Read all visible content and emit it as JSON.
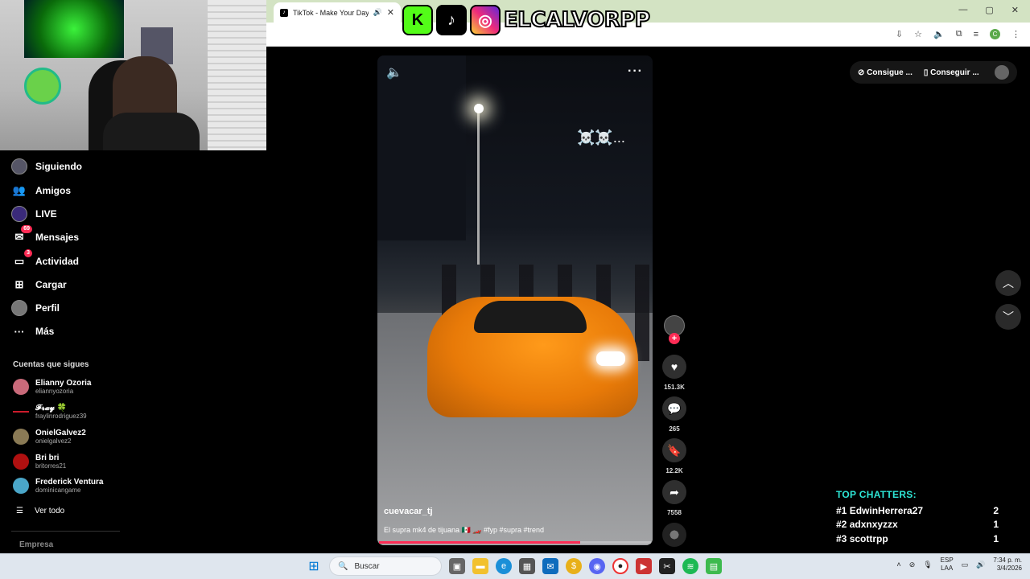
{
  "browser": {
    "tab_title": "TikTok - Make Your Day",
    "tab_close": "✕",
    "window_controls": [
      "—",
      "▢",
      "✕"
    ]
  },
  "overlay": {
    "channel_name": "ELCALVORPP"
  },
  "sidebar": {
    "items": [
      {
        "label": "Siguiendo",
        "icon": "avatar-icon"
      },
      {
        "label": "Amigos",
        "icon": "friends-icon"
      },
      {
        "label": "LIVE",
        "icon": "live-icon"
      },
      {
        "label": "Mensajes",
        "icon": "messages-icon",
        "badge": "69"
      },
      {
        "label": "Actividad",
        "icon": "activity-icon",
        "badge": "3"
      },
      {
        "label": "Cargar",
        "icon": "upload-icon"
      },
      {
        "label": "Perfil",
        "icon": "profile-icon"
      },
      {
        "label": "Más",
        "icon": "more-icon"
      }
    ],
    "following_title": "Cuentas que sigues",
    "following": [
      {
        "name": "Elianny Ozoria",
        "handle": "eliannyozoria",
        "color": "#c96a7a"
      },
      {
        "name": "𝓕𝓻𝓪𝔂 🍀",
        "handle": "fraylinrodriguez39",
        "color": "#cc1b2b"
      },
      {
        "name": "OnielGalvez2",
        "handle": "onielgalvez2",
        "color": "#8a7a55"
      },
      {
        "name": "Bri bri",
        "handle": "britorres21",
        "color": "#b01010"
      },
      {
        "name": "Frederick Ventura",
        "handle": "dominicangame",
        "color": "#4aa6c8"
      }
    ],
    "see_all": "Ver todo",
    "footer": "Empresa"
  },
  "video": {
    "author": "cuevacar_tj",
    "caption": "El supra mk4 de tijuana 🇲🇽 🏎️ #fyp #supra #trend",
    "overlay_text": "☠️☠️...",
    "progress": 0.74
  },
  "actions": {
    "likes": "151.3K",
    "comments": "265",
    "saves": "12.2K",
    "shares": "7558"
  },
  "topright": {
    "btn1": "Consigue ...",
    "btn2": "Conseguir ..."
  },
  "chatters": {
    "title": "TOP CHATTERS:",
    "rows": [
      {
        "rank": "#1",
        "name": "EdwinHerrera27",
        "count": "2"
      },
      {
        "rank": "#2",
        "name": "adxnxyzzx",
        "count": "1"
      },
      {
        "rank": "#3",
        "name": "scottrpp",
        "count": "1"
      }
    ]
  },
  "taskbar": {
    "search_placeholder": "Buscar",
    "lang_top": "ESP",
    "lang_bottom": "LAA",
    "time": "7:34 p. m.",
    "date": "3/4/2026"
  },
  "colors": {
    "accent": "#fe2c55",
    "chatters_title": "#2ee6d6",
    "chrome_frame": "#d3e3c3"
  }
}
